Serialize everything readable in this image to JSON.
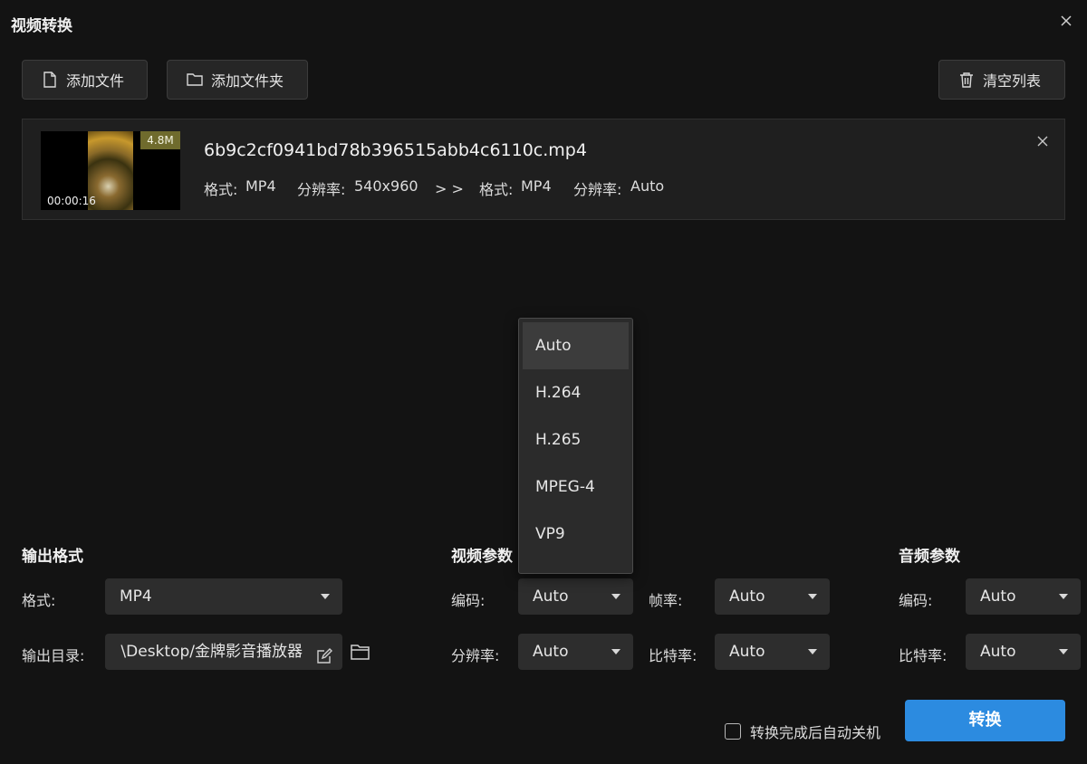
{
  "window": {
    "title": "视频转换"
  },
  "toolbar": {
    "add_file": "添加文件",
    "add_folder": "添加文件夹",
    "clear_list": "清空列表"
  },
  "file": {
    "name": "6b9c2cf0941bd78b396515abb4c6110c.mp4",
    "size": "4.8M",
    "duration": "00:00:16",
    "src_format_label": "格式:",
    "src_format": "MP4",
    "src_res_label": "分辨率:",
    "src_res": "540x960",
    "arrow": "> >",
    "dst_format_label": "格式:",
    "dst_format": "MP4",
    "dst_res_label": "分辨率:",
    "dst_res": "Auto"
  },
  "output": {
    "section_title": "输出格式",
    "format_label": "格式:",
    "format_value": "MP4",
    "dir_label": "输出目录:",
    "dir_value": "\\Desktop/金牌影音播放器"
  },
  "video": {
    "section_title": "视频参数",
    "codec_label": "编码:",
    "codec_value": "Auto",
    "fps_label": "帧率:",
    "fps_value": "Auto",
    "res_label": "分辨率:",
    "res_value": "Auto",
    "bitrate_label": "比特率:",
    "bitrate_value": "Auto"
  },
  "audio": {
    "section_title": "音频参数",
    "codec_label": "编码:",
    "codec_value": "Auto",
    "bitrate_label": "比特率:",
    "bitrate_value": "Auto"
  },
  "codec_dropdown": {
    "options": [
      "Auto",
      "H.264",
      "H.265",
      "MPEG-4",
      "VP9"
    ],
    "selected": "Auto"
  },
  "footer": {
    "auto_shutdown_label": "转换完成后自动关机",
    "auto_shutdown_checked": false,
    "convert_button": "转换"
  },
  "colors": {
    "background": "#131313",
    "accent": "#2c8be0",
    "size_badge": "#6f6b2d"
  }
}
